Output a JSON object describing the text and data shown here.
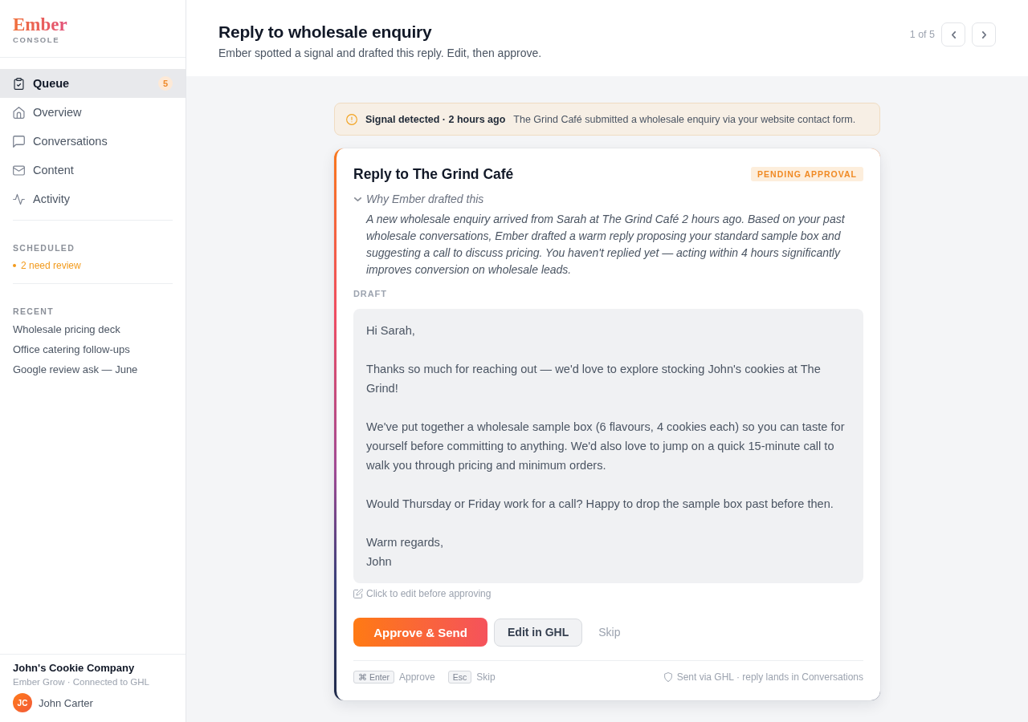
{
  "sidebar": {
    "brand": {
      "name": "Ember",
      "subtitle": "CONSOLE"
    },
    "nav": [
      {
        "label": "Queue",
        "selected": true,
        "badge": "5"
      },
      {
        "label": "Overview",
        "selected": false
      },
      {
        "label": "Conversations",
        "selected": false
      },
      {
        "label": "Content",
        "selected": false
      },
      {
        "label": "Activity",
        "selected": false
      }
    ],
    "scheduled": {
      "heading": "SCHEDULED",
      "status": "2 need review"
    },
    "recent": {
      "heading": "RECENT",
      "items": [
        "Wholesale pricing deck",
        "Office catering follow-ups",
        "Google review ask — June"
      ]
    },
    "account": {
      "company": "John's Cookie Company",
      "plan": "Ember Grow · Connected to GHL",
      "user": {
        "initials": "JC",
        "name": "John Carter"
      }
    }
  },
  "header": {
    "title": "Reply to wholesale enquiry",
    "subtitle": "Ember spotted a signal and drafted this reply. Edit, then approve.",
    "pager": "1 of 5"
  },
  "signal": {
    "heading": "Signal detected · 2 hours ago",
    "message": "The Grind Café submitted a wholesale enquiry via your website contact form."
  },
  "card": {
    "title": "Reply to The Grind Café",
    "status": "PENDING APPROVAL",
    "rationale": {
      "label": "Why Ember drafted this",
      "expanded": true,
      "text": "A new wholesale enquiry arrived from Sarah at The Grind Café 2 hours ago. Based on your past wholesale conversations, Ember drafted a warm reply proposing your standard sample box and suggesting a call to discuss pricing. You haven't replied yet — acting within 4 hours significantly improves conversion on wholesale leads."
    },
    "draft": {
      "label": "DRAFT",
      "body": "Hi Sarah,\n\nThanks so much for reaching out — we'd love to explore stocking John's cookies at The Grind!\n\nWe've put together a wholesale sample box (6 flavours, 4 cookies each) so you can taste for yourself before committing to anything. We'd also love to jump on a quick 15-minute call to walk you through pricing and minimum orders.\n\nWould Thursday or Friday work for a call? Happy to drop the sample box past before then.\n\nWarm regards,\nJohn",
      "hint": "Click to edit before approving"
    },
    "actions": [
      {
        "label": "Approve & Send",
        "kind": "primary"
      },
      {
        "label": "Edit in GHL",
        "kind": "secondary"
      },
      {
        "label": "Skip",
        "kind": "ghost"
      }
    ],
    "shortcuts": [
      {
        "key": "⌘ Enter",
        "action": "Approve"
      },
      {
        "key": "Esc",
        "action": "Skip"
      }
    ],
    "delivery_note": "Sent via GHL · reply lands in Conversations"
  }
}
